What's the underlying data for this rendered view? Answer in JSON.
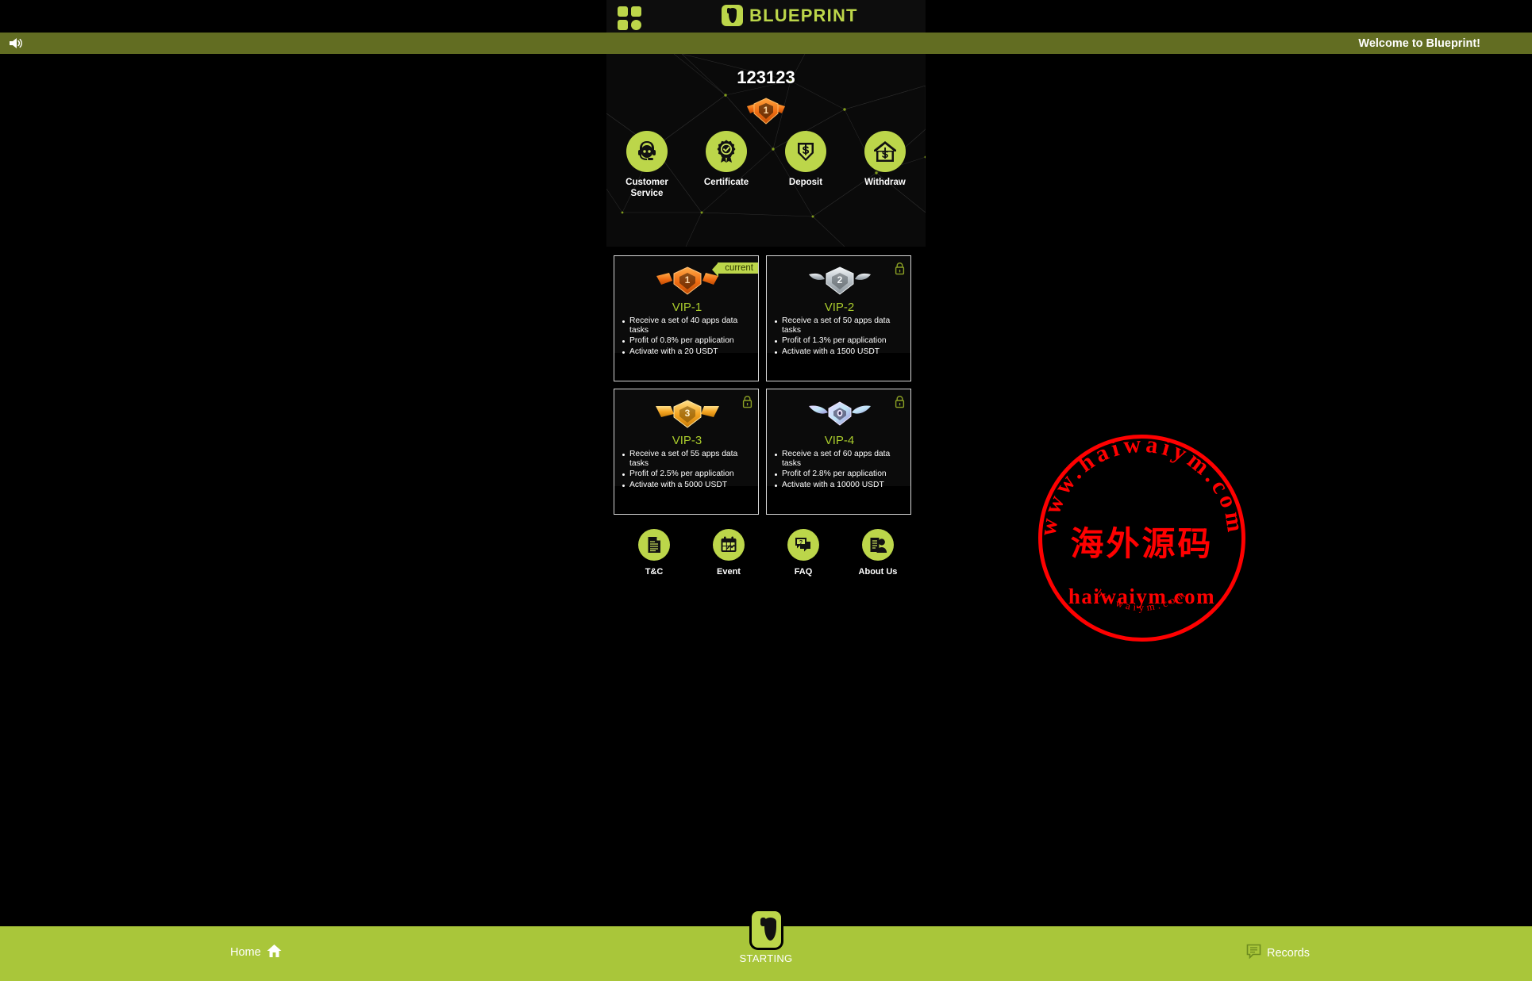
{
  "header": {
    "grid_icon": "grid-apps-icon",
    "brand_name": "BLUEPRINT",
    "brand_logo": "blueprint-logo-icon"
  },
  "notice": {
    "speaker_icon": "speaker-icon",
    "text": "Welcome to Blueprint!"
  },
  "profile": {
    "user_id": "123123",
    "rank_badge_icon": "vip-1-rank-badge-icon"
  },
  "quick_actions": [
    {
      "label": "Customer Service",
      "icon": "customer-service-icon"
    },
    {
      "label": "Certificate",
      "icon": "certificate-icon"
    },
    {
      "label": "Deposit",
      "icon": "deposit-icon"
    },
    {
      "label": "Withdraw",
      "icon": "withdraw-icon"
    }
  ],
  "vip_levels": [
    {
      "title": "VIP-1",
      "badge_icon": "vip-1-badge-icon",
      "state": "current",
      "state_label": "current",
      "locked": false,
      "perks": [
        "Receive a set of 40 apps data tasks",
        "Profit of 0.8% per application",
        "Activate with a 20 USDT"
      ]
    },
    {
      "title": "VIP-2",
      "badge_icon": "vip-2-badge-icon",
      "state": "locked",
      "state_label": "",
      "locked": true,
      "perks": [
        "Receive a set of 50 apps data tasks",
        "Profit of 1.3% per application",
        "Activate with a 1500 USDT"
      ]
    },
    {
      "title": "VIP-3",
      "badge_icon": "vip-3-badge-icon",
      "state": "locked",
      "state_label": "",
      "locked": true,
      "perks": [
        "Receive a set of 55 apps data tasks",
        "Profit of 2.5% per application",
        "Activate with a 5000 USDT"
      ]
    },
    {
      "title": "VIP-4",
      "badge_icon": "vip-4-badge-icon",
      "state": "locked",
      "state_label": "",
      "locked": true,
      "perks": [
        "Receive a set of 60 apps data tasks",
        "Profit of 2.8% per application",
        "Activate with a 10000 USDT"
      ]
    }
  ],
  "info_links": [
    {
      "label": "T&C",
      "icon": "document-icon"
    },
    {
      "label": "Event",
      "icon": "calendar-icon"
    },
    {
      "label": "FAQ",
      "icon": "question-chat-icon"
    },
    {
      "label": "About Us",
      "icon": "person-info-icon"
    }
  ],
  "bottom_nav": {
    "home_label": "Home",
    "home_icon": "home-icon",
    "center_label": "STARTING",
    "center_icon": "blueprint-logo-icon",
    "records_label": "Records",
    "records_icon": "records-icon"
  },
  "watermark": {
    "outer_top_text": "www.haiwaiym.com",
    "center_text": "海外源码",
    "mid_text": "haiwaiym.com",
    "outer_bottom_text": "haiwaiym.com",
    "color": "#ff0000"
  },
  "colors": {
    "accent_green": "#bcd64a",
    "nav_green": "#a9c63a",
    "notice_green": "#626d22",
    "vip_title_green": "#aacc2c",
    "background": "#000000"
  }
}
